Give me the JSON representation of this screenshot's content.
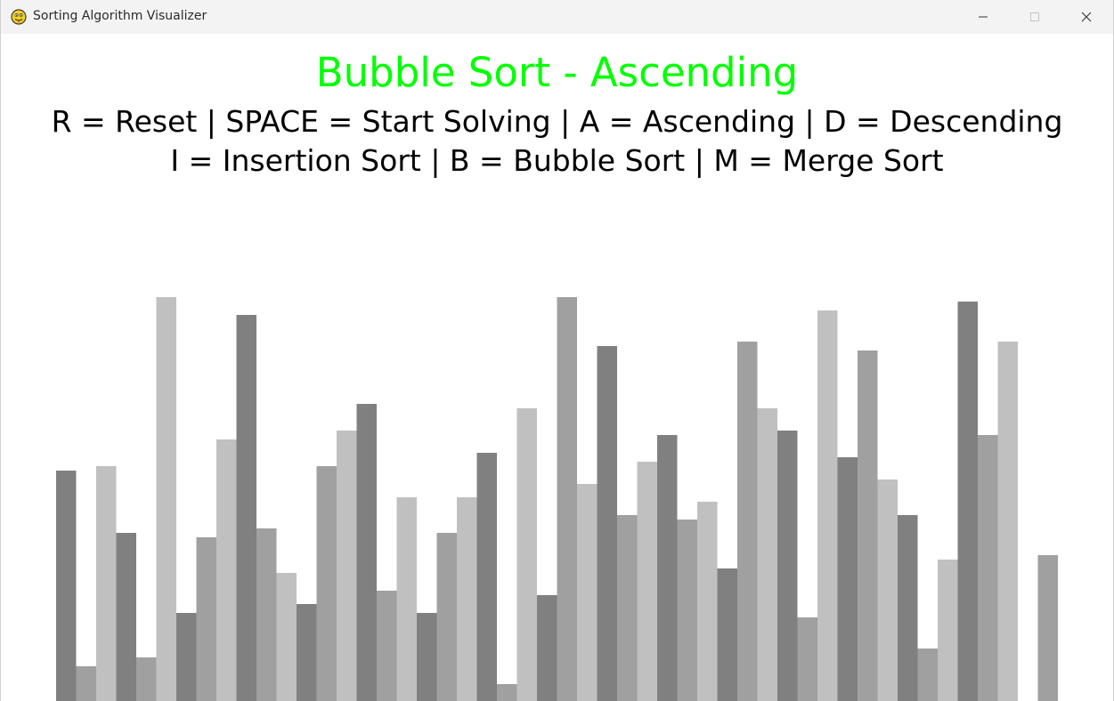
{
  "window": {
    "title": "Sorting Algorithm Visualizer",
    "icon": "pygame-snake-icon",
    "controls": [
      "minimize-icon",
      "maximize-icon",
      "close-icon"
    ]
  },
  "visualizer": {
    "title": "Bubble Sort - Ascending",
    "title_color": "#00ff00",
    "instructions_line1": "R = Reset | SPACE = Start Solving | A = Ascending | D = Descending",
    "instructions_line2": "I = Insertion Sort | B = Bubble Sort | M = Merge Sort",
    "bar_colors": [
      "#808080",
      "#a0a0a0",
      "#c0c0c0"
    ]
  },
  "chart_data": {
    "type": "bar",
    "values": [
      259,
      39,
      264,
      189,
      49,
      454,
      99,
      184,
      294,
      434,
      194,
      144,
      109,
      264,
      304,
      334,
      124,
      229,
      99,
      189,
      229,
      279,
      19,
      329,
      119,
      454,
      244,
      399,
      209,
      269,
      299,
      204,
      224,
      149,
      404,
      329,
      304,
      94,
      439,
      274,
      394,
      249,
      209,
      59,
      159,
      449,
      299,
      404,
      0,
      164
    ],
    "ylim": [
      0,
      460
    ]
  }
}
